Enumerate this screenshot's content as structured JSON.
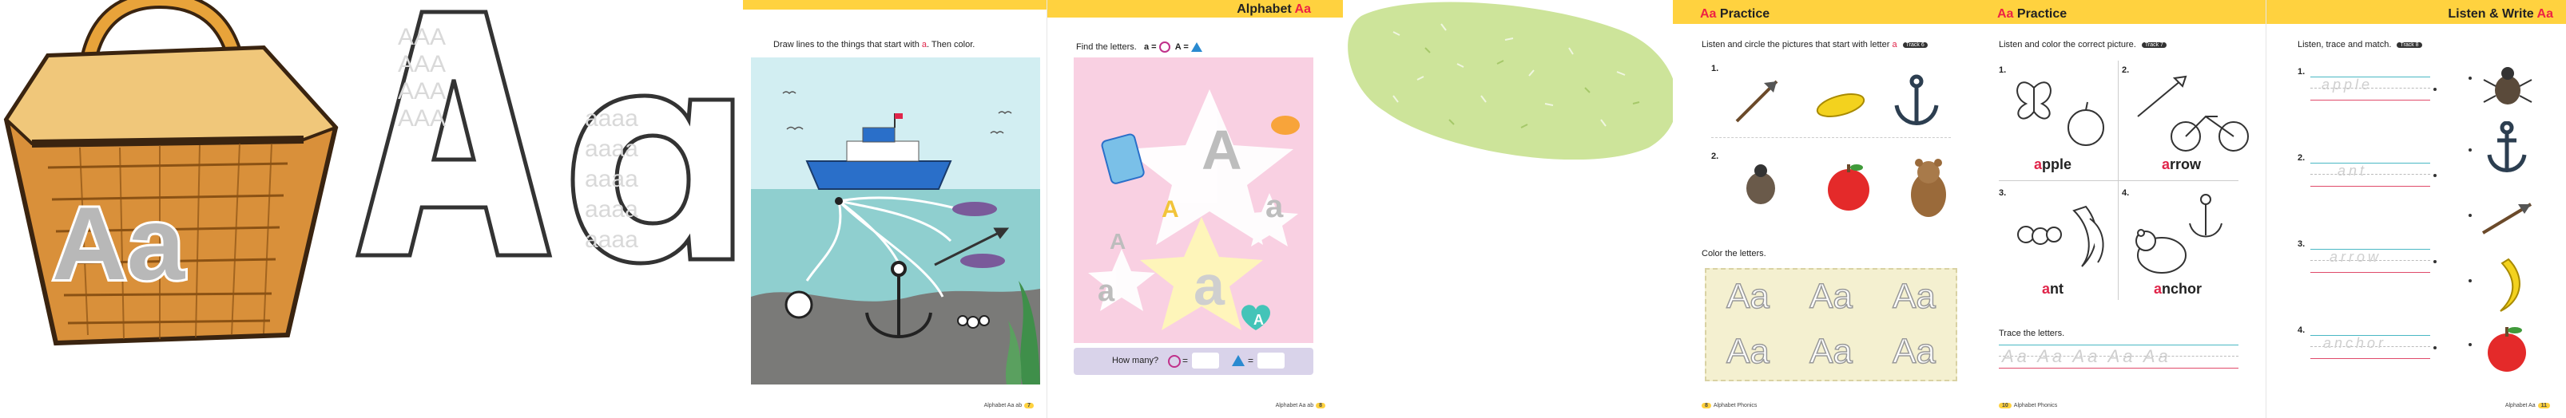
{
  "cover": {
    "basket_letters": "Aa",
    "big_upper": "A",
    "big_lower": "a",
    "pattern_upper": "A",
    "pattern_lower": "a"
  },
  "page_scene": {
    "instruction_text": "Draw lines to the things that start with",
    "instruction_letter": "a",
    "instruction_end": ". Then color.",
    "folio_text": "Alphabet Aa",
    "folio_suffix": "ab",
    "page_number": "7"
  },
  "page_find": {
    "header_title": "Alphabet",
    "header_tag": "Aa",
    "instruction": "Find the letters.",
    "key_lower": "a =",
    "key_upper": "A =",
    "how_many": "How many?",
    "eq": "=",
    "folio_text": "Alphabet",
    "folio_suffix": "Aa",
    "folio_extra": "ab",
    "page_number": "8"
  },
  "page_practice1": {
    "header_tag": "Aa",
    "header_title": "Practice",
    "instruction": "Listen and circle the pictures that start with letter",
    "instruction_letter": "a",
    "ribbon": "Track 6",
    "row_numbers": [
      "1.",
      "2."
    ],
    "color_instruction": "Color the letters.",
    "outline_letters": [
      "Aa",
      "Aa",
      "Aa",
      "Aa",
      "Aa",
      "Aa"
    ],
    "folio_text": "Alphabet Phonics",
    "page_number": "8"
  },
  "page_practice2": {
    "header_tag": "Aa",
    "header_title": "Practice",
    "instruction": "Listen and color the correct picture.",
    "ribbon": "Track 7",
    "items": [
      {
        "num": "1.",
        "first": "a",
        "rest": "pple"
      },
      {
        "num": "2.",
        "first": "a",
        "rest": "rrow"
      },
      {
        "num": "3.",
        "first": "a",
        "rest": "nt"
      },
      {
        "num": "4.",
        "first": "a",
        "rest": "nchor"
      }
    ],
    "trace_instruction": "Trace the letters.",
    "trace_text": "Aa Aa Aa Aa Aa",
    "folio_text": "Alphabet Phonics",
    "page_number": "10"
  },
  "page_listen": {
    "header_title": "Listen & Write",
    "header_tag": "Aa",
    "instruction": "Listen, trace and match.",
    "ribbon": "Track 8",
    "items": [
      {
        "num": "1.",
        "trace": "apple"
      },
      {
        "num": "2.",
        "trace": "ant"
      },
      {
        "num": "3.",
        "trace": "arrow"
      },
      {
        "num": "4.",
        "trace": "anchor"
      }
    ],
    "folio_text": "Alphabet",
    "folio_suffix": "Aa",
    "page_number": "11"
  },
  "colors": {
    "accent_yellow": "#ffd23f",
    "letter_red": "#e0254a",
    "sky": "#bfe6ee",
    "sea": "#7fc3c4",
    "pink": "#f7c8dc",
    "green_blob": "#cde49a"
  }
}
